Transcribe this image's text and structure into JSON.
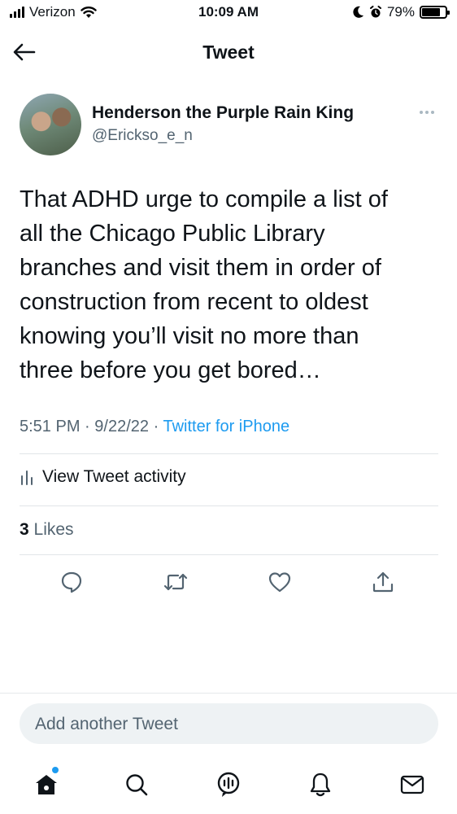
{
  "status_bar": {
    "carrier": "Verizon",
    "time": "10:09 AM",
    "battery_pct": "79%",
    "battery_level": 0.79
  },
  "header": {
    "title": "Tweet",
    "back_icon": "back-arrow-icon"
  },
  "tweet": {
    "author_name": "Henderson the Purple Rain King",
    "author_handle": "@Erickso_e_n",
    "text": "That ADHD urge to compile a list of\nall the Chicago Public Library\nbranches and visit them in order of\nconstruction from recent to oldest\nknowing you’ll visit no more than\nthree before you get bored…",
    "time": "5:51 PM",
    "separator": "·",
    "date": "9/22/22",
    "source": "Twitter for iPhone",
    "activity_label": "View Tweet activity",
    "likes_count": "3",
    "likes_label": "Likes"
  },
  "actions": [
    "reply-icon",
    "retweet-icon",
    "like-icon",
    "share-icon"
  ],
  "compose": {
    "placeholder": "Add another Tweet"
  },
  "tabs": [
    "home-icon",
    "search-icon",
    "spaces-icon",
    "notifications-icon",
    "messages-icon"
  ],
  "colors": {
    "accent": "#1d9bf0",
    "text": "#0f1419",
    "secondary": "#536471"
  }
}
